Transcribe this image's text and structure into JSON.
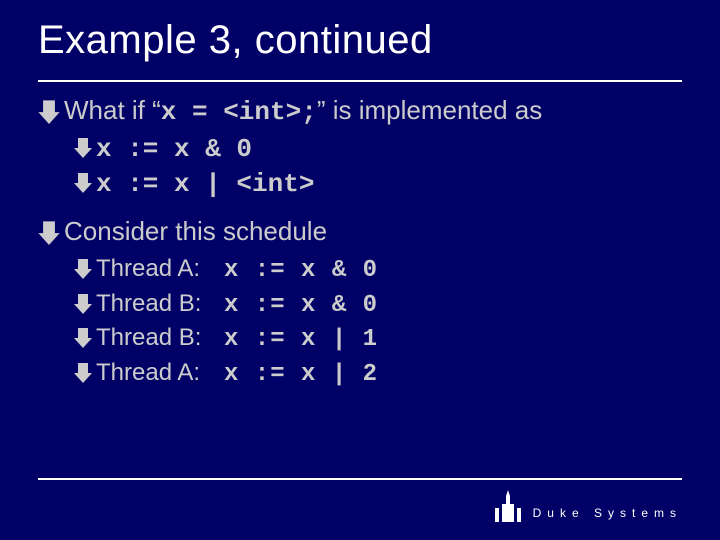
{
  "title": "Example 3, continued",
  "bullet1": {
    "prefix": "What if “",
    "code": "x = <int>;",
    "suffix": "” is implemented as"
  },
  "sub1": "x := x & 0",
  "sub2": "x := x | <int>",
  "bullet2": "Consider this schedule",
  "schedule": [
    {
      "label": "Thread A:",
      "code": "x := x & 0"
    },
    {
      "label": "Thread B:",
      "code": "x := x & 0"
    },
    {
      "label": "Thread B:",
      "code": "x := x | 1"
    },
    {
      "label": "Thread A:",
      "code": "x := x | 2"
    }
  ],
  "footer": {
    "brand": "Duke Systems"
  }
}
